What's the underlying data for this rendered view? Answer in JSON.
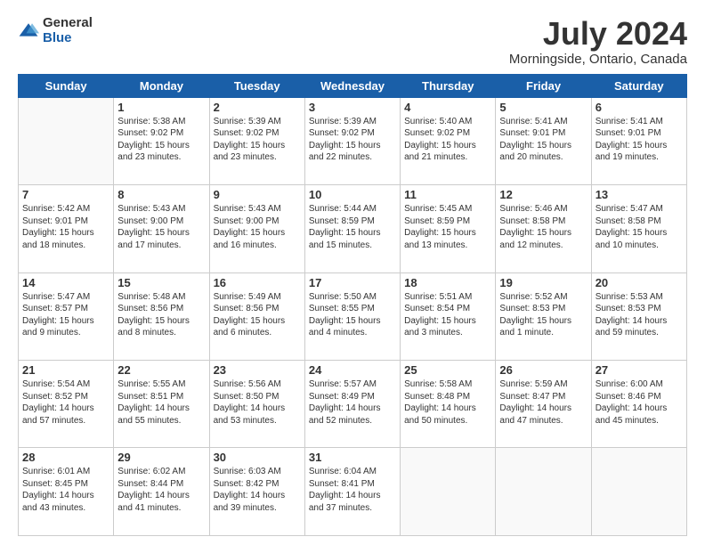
{
  "logo": {
    "general": "General",
    "blue": "Blue"
  },
  "header": {
    "title": "July 2024",
    "subtitle": "Morningside, Ontario, Canada"
  },
  "weekdays": [
    "Sunday",
    "Monday",
    "Tuesday",
    "Wednesday",
    "Thursday",
    "Friday",
    "Saturday"
  ],
  "weeks": [
    [
      {
        "day": "",
        "info": ""
      },
      {
        "day": "1",
        "info": "Sunrise: 5:38 AM\nSunset: 9:02 PM\nDaylight: 15 hours\nand 23 minutes."
      },
      {
        "day": "2",
        "info": "Sunrise: 5:39 AM\nSunset: 9:02 PM\nDaylight: 15 hours\nand 23 minutes."
      },
      {
        "day": "3",
        "info": "Sunrise: 5:39 AM\nSunset: 9:02 PM\nDaylight: 15 hours\nand 22 minutes."
      },
      {
        "day": "4",
        "info": "Sunrise: 5:40 AM\nSunset: 9:02 PM\nDaylight: 15 hours\nand 21 minutes."
      },
      {
        "day": "5",
        "info": "Sunrise: 5:41 AM\nSunset: 9:01 PM\nDaylight: 15 hours\nand 20 minutes."
      },
      {
        "day": "6",
        "info": "Sunrise: 5:41 AM\nSunset: 9:01 PM\nDaylight: 15 hours\nand 19 minutes."
      }
    ],
    [
      {
        "day": "7",
        "info": "Sunrise: 5:42 AM\nSunset: 9:01 PM\nDaylight: 15 hours\nand 18 minutes."
      },
      {
        "day": "8",
        "info": "Sunrise: 5:43 AM\nSunset: 9:00 PM\nDaylight: 15 hours\nand 17 minutes."
      },
      {
        "day": "9",
        "info": "Sunrise: 5:43 AM\nSunset: 9:00 PM\nDaylight: 15 hours\nand 16 minutes."
      },
      {
        "day": "10",
        "info": "Sunrise: 5:44 AM\nSunset: 8:59 PM\nDaylight: 15 hours\nand 15 minutes."
      },
      {
        "day": "11",
        "info": "Sunrise: 5:45 AM\nSunset: 8:59 PM\nDaylight: 15 hours\nand 13 minutes."
      },
      {
        "day": "12",
        "info": "Sunrise: 5:46 AM\nSunset: 8:58 PM\nDaylight: 15 hours\nand 12 minutes."
      },
      {
        "day": "13",
        "info": "Sunrise: 5:47 AM\nSunset: 8:58 PM\nDaylight: 15 hours\nand 10 minutes."
      }
    ],
    [
      {
        "day": "14",
        "info": "Sunrise: 5:47 AM\nSunset: 8:57 PM\nDaylight: 15 hours\nand 9 minutes."
      },
      {
        "day": "15",
        "info": "Sunrise: 5:48 AM\nSunset: 8:56 PM\nDaylight: 15 hours\nand 8 minutes."
      },
      {
        "day": "16",
        "info": "Sunrise: 5:49 AM\nSunset: 8:56 PM\nDaylight: 15 hours\nand 6 minutes."
      },
      {
        "day": "17",
        "info": "Sunrise: 5:50 AM\nSunset: 8:55 PM\nDaylight: 15 hours\nand 4 minutes."
      },
      {
        "day": "18",
        "info": "Sunrise: 5:51 AM\nSunset: 8:54 PM\nDaylight: 15 hours\nand 3 minutes."
      },
      {
        "day": "19",
        "info": "Sunrise: 5:52 AM\nSunset: 8:53 PM\nDaylight: 15 hours\nand 1 minute."
      },
      {
        "day": "20",
        "info": "Sunrise: 5:53 AM\nSunset: 8:53 PM\nDaylight: 14 hours\nand 59 minutes."
      }
    ],
    [
      {
        "day": "21",
        "info": "Sunrise: 5:54 AM\nSunset: 8:52 PM\nDaylight: 14 hours\nand 57 minutes."
      },
      {
        "day": "22",
        "info": "Sunrise: 5:55 AM\nSunset: 8:51 PM\nDaylight: 14 hours\nand 55 minutes."
      },
      {
        "day": "23",
        "info": "Sunrise: 5:56 AM\nSunset: 8:50 PM\nDaylight: 14 hours\nand 53 minutes."
      },
      {
        "day": "24",
        "info": "Sunrise: 5:57 AM\nSunset: 8:49 PM\nDaylight: 14 hours\nand 52 minutes."
      },
      {
        "day": "25",
        "info": "Sunrise: 5:58 AM\nSunset: 8:48 PM\nDaylight: 14 hours\nand 50 minutes."
      },
      {
        "day": "26",
        "info": "Sunrise: 5:59 AM\nSunset: 8:47 PM\nDaylight: 14 hours\nand 47 minutes."
      },
      {
        "day": "27",
        "info": "Sunrise: 6:00 AM\nSunset: 8:46 PM\nDaylight: 14 hours\nand 45 minutes."
      }
    ],
    [
      {
        "day": "28",
        "info": "Sunrise: 6:01 AM\nSunset: 8:45 PM\nDaylight: 14 hours\nand 43 minutes."
      },
      {
        "day": "29",
        "info": "Sunrise: 6:02 AM\nSunset: 8:44 PM\nDaylight: 14 hours\nand 41 minutes."
      },
      {
        "day": "30",
        "info": "Sunrise: 6:03 AM\nSunset: 8:42 PM\nDaylight: 14 hours\nand 39 minutes."
      },
      {
        "day": "31",
        "info": "Sunrise: 6:04 AM\nSunset: 8:41 PM\nDaylight: 14 hours\nand 37 minutes."
      },
      {
        "day": "",
        "info": ""
      },
      {
        "day": "",
        "info": ""
      },
      {
        "day": "",
        "info": ""
      }
    ]
  ]
}
